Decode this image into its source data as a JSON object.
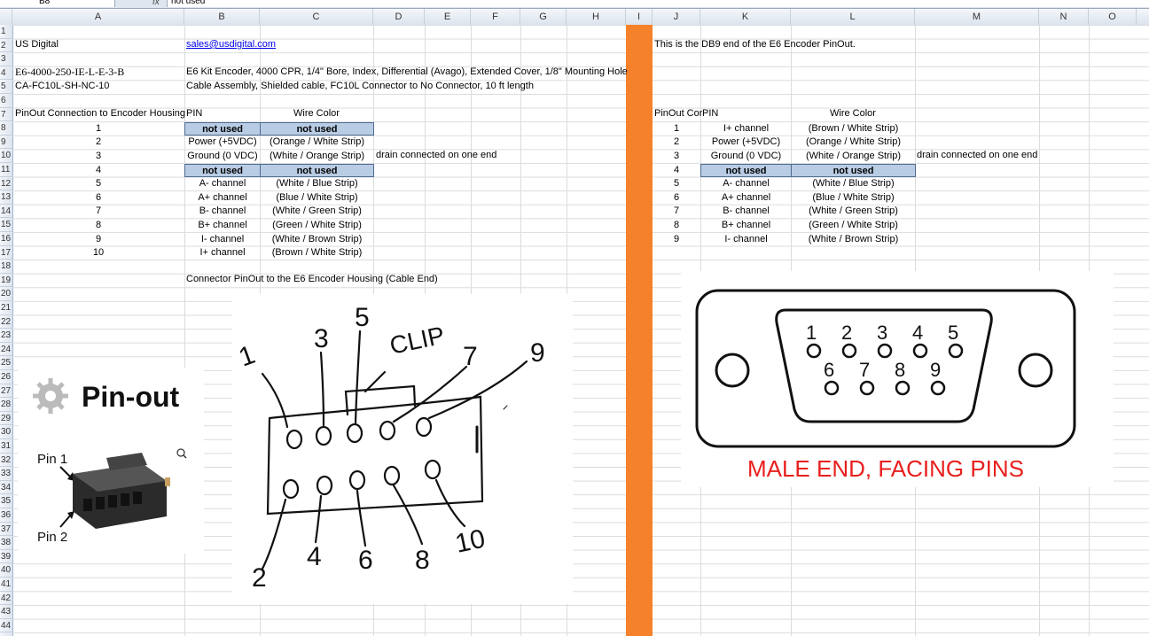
{
  "formula_bar": {
    "name_box": "B8",
    "fx": "fx",
    "value": "not used"
  },
  "columns": [
    "A",
    "B",
    "C",
    "D",
    "E",
    "F",
    "G",
    "H",
    "I",
    "J",
    "K",
    "L",
    "M",
    "N",
    "O"
  ],
  "rows": [
    "1",
    "2",
    "3",
    "4",
    "5",
    "6",
    "7",
    "8",
    "9",
    "10",
    "11",
    "12",
    "13",
    "14",
    "15",
    "16",
    "17",
    "18",
    "19",
    "20",
    "21",
    "22",
    "23",
    "24",
    "25",
    "26",
    "27",
    "28",
    "29",
    "30",
    "31",
    "32",
    "33",
    "34",
    "35",
    "36",
    "37",
    "38",
    "39",
    "40",
    "41",
    "42",
    "43",
    "44"
  ],
  "sheet": {
    "company": "US Digital",
    "email": "sales@usdigital.com",
    "part_number": "E6-4000-250-IE-L-E-3-B",
    "part_desc": "E6 Kit Encoder, 4000 CPR, 1/4\" Bore, Index, Differential (Avago), Extended Cover, 1/8\" Mounting Hole",
    "cable_number": "CA-FC10L-SH-NC-10",
    "cable_desc": "Cable Assembly, Shielded cable, FC10L Connector to No Connector, 10 ft length",
    "left_table_title": "PinOut Connection to Encoder Housing",
    "pin_header": "PIN",
    "wire_header": "Wire Color",
    "drain_note": "drain connected on one end",
    "connector_caption": "Connector PinOut to the E6 Encoder Housing (Cable End)",
    "left_rows": [
      {
        "n": "1",
        "pin": "not used",
        "wire": "not used",
        "shade": true
      },
      {
        "n": "2",
        "pin": "Power (+5VDC)",
        "wire": "(Orange / White Strip)",
        "shade": false
      },
      {
        "n": "3",
        "pin": "Ground (0 VDC)",
        "wire": "(White / Orange Strip)",
        "shade": false
      },
      {
        "n": "4",
        "pin": "not used",
        "wire": "not used",
        "shade": true
      },
      {
        "n": "5",
        "pin": "A- channel",
        "wire": "(White / Blue Strip)",
        "shade": false
      },
      {
        "n": "6",
        "pin": "A+ channel",
        "wire": "(Blue / White Strip)",
        "shade": false
      },
      {
        "n": "7",
        "pin": "B- channel",
        "wire": "(White / Green Strip)",
        "shade": false
      },
      {
        "n": "8",
        "pin": "B+ channel",
        "wire": "(Green / White Strip)",
        "shade": false
      },
      {
        "n": "9",
        "pin": "I- channel",
        "wire": "(White / Brown Strip)",
        "shade": false
      },
      {
        "n": "10",
        "pin": "I+ channel",
        "wire": "(Brown / White Strip)",
        "shade": false
      }
    ],
    "db9_note": "This is the DB9 end of the E6 Encoder PinOut.",
    "right_table_title": "PinOut Cor",
    "right_rows": [
      {
        "n": "1",
        "pin": "I+ channel",
        "wire": "(Brown / White Strip)",
        "shade": false
      },
      {
        "n": "2",
        "pin": "Power (+5VDC)",
        "wire": "(Orange / White Strip)",
        "shade": false
      },
      {
        "n": "3",
        "pin": "Ground (0 VDC)",
        "wire": "(White / Orange Strip)",
        "shade": false
      },
      {
        "n": "4",
        "pin": "not used",
        "wire": "not used",
        "shade": true
      },
      {
        "n": "5",
        "pin": "A- channel",
        "wire": "(White / Blue Strip)",
        "shade": false
      },
      {
        "n": "6",
        "pin": "A+ channel",
        "wire": "(Blue / White Strip)",
        "shade": false
      },
      {
        "n": "7",
        "pin": "B- channel",
        "wire": "(White / Green Strip)",
        "shade": false
      },
      {
        "n": "8",
        "pin": "B+ channel",
        "wire": "(Green / White Strip)",
        "shade": false
      },
      {
        "n": "9",
        "pin": "I- channel",
        "wire": "(White / Brown Strip)",
        "shade": false
      }
    ]
  },
  "pinout_image": {
    "title": "Pin-out",
    "pin1": "Pin 1",
    "pin2": "Pin 2",
    "icon": "gear-icon"
  },
  "sketch": {
    "top_labels": [
      "1",
      "3",
      "5",
      "7",
      "9"
    ],
    "bottom_labels": [
      "2",
      "4",
      "6",
      "8",
      "10"
    ],
    "clip": "CLIP"
  },
  "db9_image": {
    "top_pins": [
      "1",
      "2",
      "3",
      "4",
      "5"
    ],
    "bottom_pins": [
      "6",
      "7",
      "8",
      "9"
    ],
    "caption": "MALE END, FACING PINS",
    "caption_color": "#e8201e"
  },
  "colors": {
    "orange_column": "#f5822a",
    "shaded_cell": "#b8cce4"
  }
}
